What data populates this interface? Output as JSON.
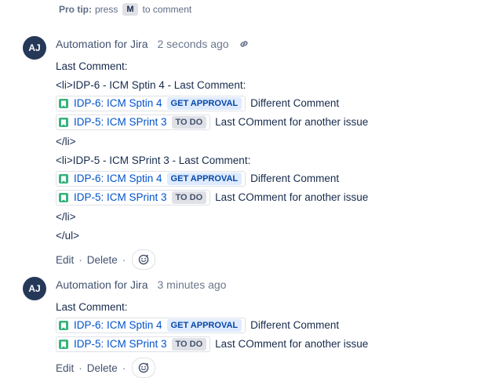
{
  "protip": {
    "label": "Pro tip:",
    "text_before": "press",
    "key": "M",
    "text_after": "to comment"
  },
  "icons": {
    "link": "link-icon",
    "story": "story-icon",
    "reaction": "add-reaction-icon"
  },
  "colors": {
    "link": "#0052cc",
    "story_icon": "#36b37e",
    "avatar": "#253858"
  },
  "comments": [
    {
      "avatar": "AJ",
      "author": "Automation for Jira",
      "time": "2 seconds ago",
      "lines": [
        "Last Comment:",
        "<li>IDP-6 - ICM Sptin 4 - Last Comment:",
        "</li>",
        "<li>IDP-5 - ICM SPrint 3 - Last Comment:",
        "</li>",
        "</ul>"
      ],
      "issues": [
        {
          "key": "IDP-6: ICM Sptin 4",
          "status": "GET APPROVAL",
          "text": "Different Comment"
        },
        {
          "key": "IDP-5: ICM SPrint 3",
          "status": "TO DO",
          "text": "Last COmment for another issue"
        },
        {
          "key": "IDP-6: ICM Sptin 4",
          "status": "GET APPROVAL",
          "text": "Different Comment"
        },
        {
          "key": "IDP-5: ICM SPrint 3",
          "status": "TO DO",
          "text": "Last COmment for another issue"
        }
      ],
      "actions": {
        "edit": "Edit",
        "delete": "Delete",
        "sep": "·"
      }
    },
    {
      "avatar": "AJ",
      "author": "Automation for Jira",
      "time": "3 minutes ago",
      "lines": [
        "Last Comment:"
      ],
      "issues": [
        {
          "key": "IDP-6: ICM Sptin 4",
          "status": "GET APPROVAL",
          "text": "Different Comment"
        },
        {
          "key": "IDP-5: ICM SPrint 3",
          "status": "TO DO",
          "text": "Last COmment for another issue"
        }
      ],
      "actions": {
        "edit": "Edit",
        "delete": "Delete",
        "sep": "·"
      }
    }
  ]
}
